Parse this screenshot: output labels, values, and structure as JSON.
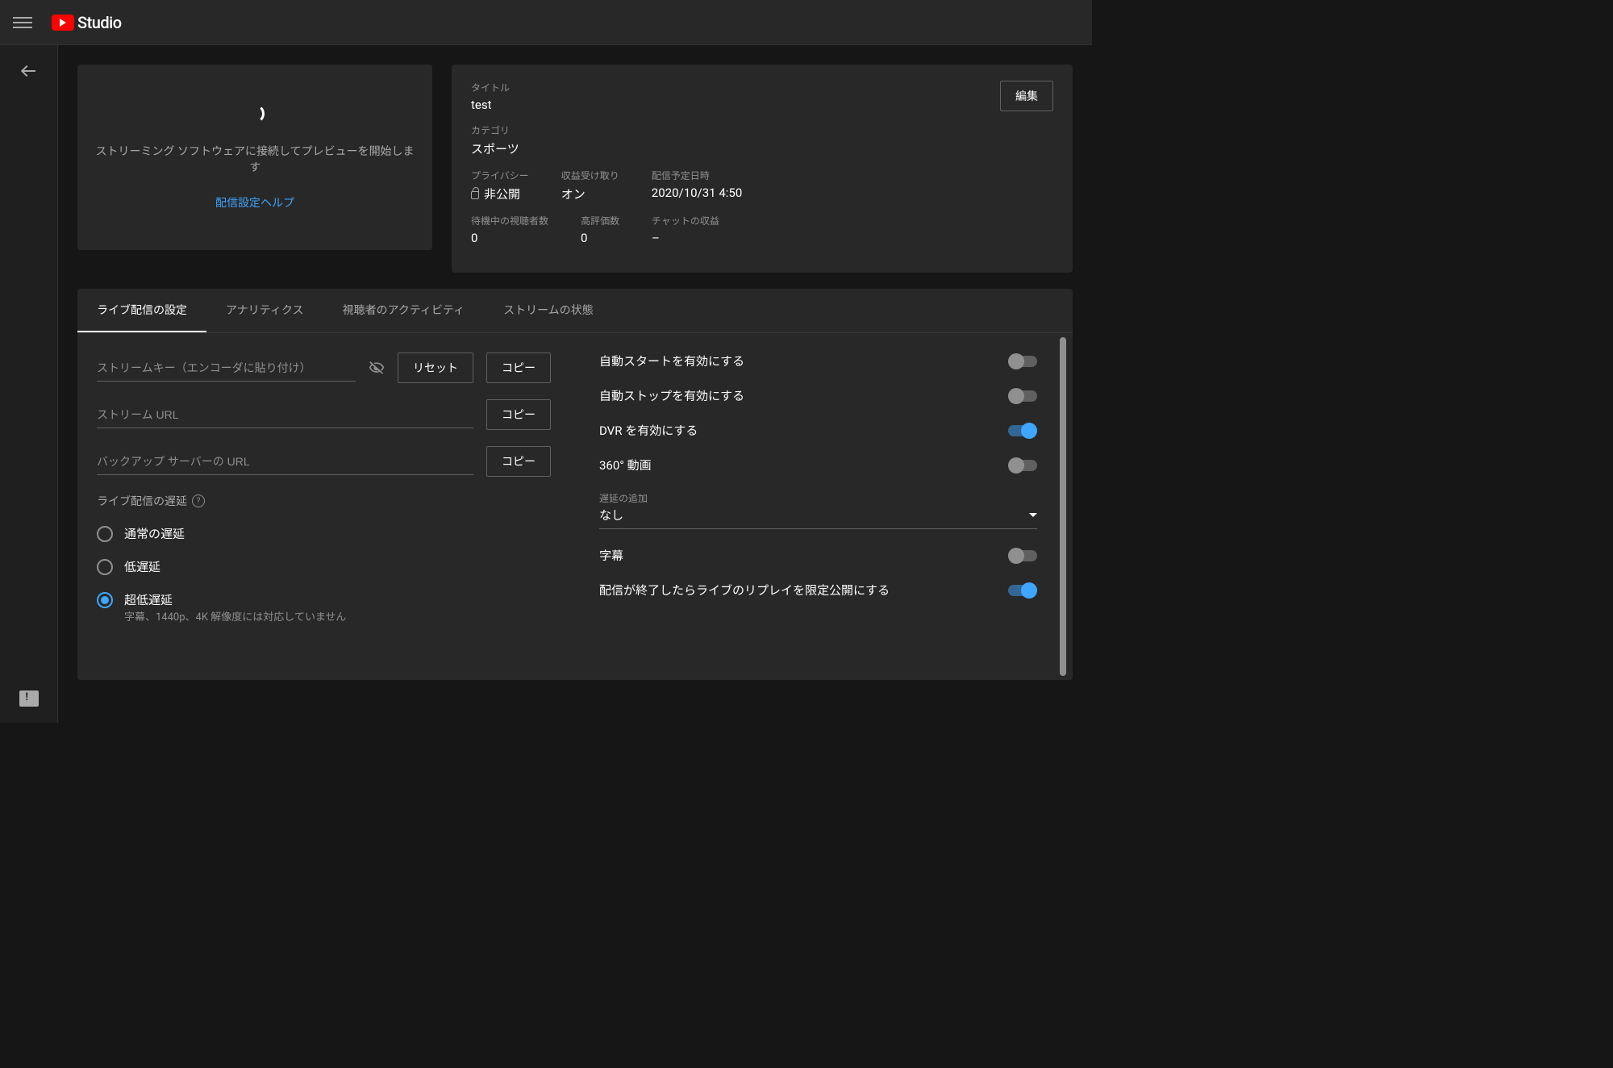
{
  "header": {
    "brand": "Studio"
  },
  "preview": {
    "message": "ストリーミング ソフトウェアに接続してプレビューを開始します",
    "help_link": "配信設定ヘルプ"
  },
  "info": {
    "edit_button": "編集",
    "title_label": "タイトル",
    "title_value": "test",
    "category_label": "カテゴリ",
    "category_value": "スポーツ",
    "privacy_label": "プライバシー",
    "privacy_value": "非公開",
    "monetization_label": "収益受け取り",
    "monetization_value": "オン",
    "scheduled_label": "配信予定日時",
    "scheduled_value": "2020/10/31 4:50",
    "waiting_label": "待機中の視聴者数",
    "waiting_value": "0",
    "likes_label": "高評価数",
    "likes_value": "0",
    "chat_rev_label": "チャットの収益",
    "chat_rev_value": "–"
  },
  "tabs": {
    "settings": "ライブ配信の設定",
    "analytics": "アナリティクス",
    "activity": "視聴者のアクティビティ",
    "health": "ストリームの状態"
  },
  "stream": {
    "key_placeholder": "ストリームキー（エンコーダに貼り付け）",
    "url_placeholder": "ストリーム URL",
    "backup_placeholder": "バックアップ サーバーの URL",
    "reset": "リセット",
    "copy": "コピー"
  },
  "latency": {
    "section": "ライブ配信の遅延",
    "normal": "通常の遅延",
    "low": "低遅延",
    "ultra_low": "超低遅延",
    "ultra_note": "字幕、1440p、4K 解像度には対応していません"
  },
  "toggles": {
    "auto_start": "自動スタートを有効にする",
    "auto_stop": "自動ストップを有効にする",
    "dvr": "DVR を有効にする",
    "video360": "360° 動画",
    "captions": "字幕",
    "unlisted_replay": "配信が終了したらライブのリプレイを限定公開にする"
  },
  "added_delay": {
    "label": "遅延の追加",
    "value": "なし"
  }
}
